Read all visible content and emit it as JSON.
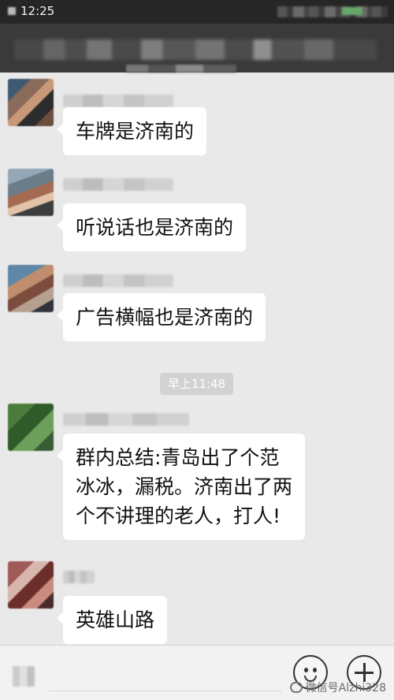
{
  "status_bar": {
    "time": "12:25"
  },
  "chat": {
    "time_divider": "早上11:48",
    "messages": [
      {
        "text": "车牌是济南的"
      },
      {
        "text": "听说话也是济南的"
      },
      {
        "text": "广告横幅也是济南的"
      },
      {
        "text": "群内总结:青岛出了个范\n冰冰，漏税。济南出了两\n个不讲理的老人，打人!"
      },
      {
        "text": "英雄山路"
      }
    ]
  },
  "watermark": {
    "text": "微信号Alzhi328"
  },
  "icons": {
    "emoji": "smiley-icon",
    "plus": "plus-icon",
    "wechat": "wechat-logo-icon"
  },
  "colors": {
    "status_bg": "#262626",
    "title_bg": "#3a3a3a",
    "chat_bg": "#e9e9e9",
    "bubble_bg": "#ffffff"
  }
}
